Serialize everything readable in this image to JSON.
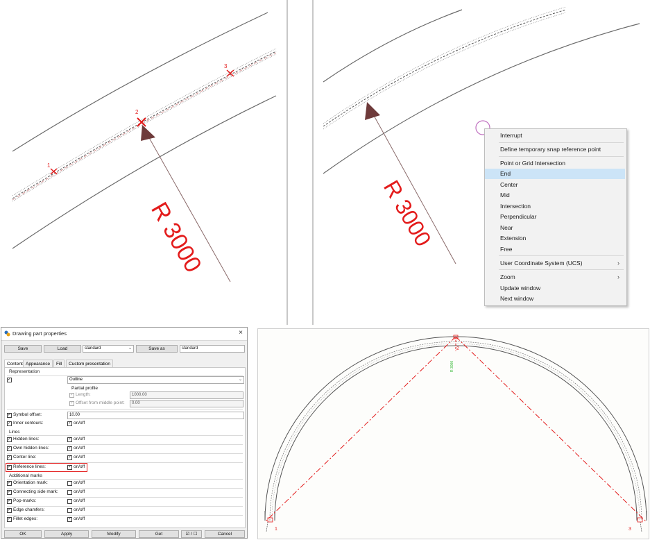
{
  "top_left": {
    "dimension_label": "R 3000",
    "point_labels": [
      "1",
      "2",
      "3"
    ]
  },
  "top_right": {
    "dimension_label": "R 3000",
    "context_menu": {
      "items": [
        {
          "label": "Interrupt"
        },
        {
          "label": "Define temporary snap reference point"
        },
        {
          "label": "Point or Grid Intersection"
        },
        {
          "label": "End",
          "selected": true
        },
        {
          "label": "Center"
        },
        {
          "label": "Mid"
        },
        {
          "label": "Intersection"
        },
        {
          "label": "Perpendicular"
        },
        {
          "label": "Near"
        },
        {
          "label": "Extension"
        },
        {
          "label": "Free"
        },
        {
          "label": "User Coordinate System (UCS)",
          "submenu": true
        },
        {
          "label": "Zoom",
          "submenu": true
        },
        {
          "label": "Update window"
        },
        {
          "label": "Next window"
        }
      ]
    }
  },
  "dialog": {
    "title": "Drawing part properties",
    "save_label": "Save",
    "load_label": "Load",
    "preset_value": "standard",
    "save_as_label": "Save as",
    "save_as_value": "standard",
    "tabs": [
      "Content",
      "Appearance",
      "Fill",
      "Custom presentation"
    ],
    "active_tab": "Content",
    "representation": {
      "section": "Representation",
      "value": "Outline",
      "partial_profile": "Partial profile",
      "length_label": "Length:",
      "length_value": "1000.00",
      "offset_label": "Offset from middle point:",
      "offset_value": "0.00",
      "symbol_offset_label": "Symbol offset:",
      "symbol_offset_value": "10.00",
      "inner_contours_label": "Inner contours:"
    },
    "onoff": "on/off",
    "lines_section": "Lines",
    "lines": [
      {
        "label": "Hidden lines:",
        "on": true
      },
      {
        "label": "Own hidden lines:",
        "on": true
      },
      {
        "label": "Center line:",
        "on": true
      },
      {
        "label": "Reference lines:",
        "on": true,
        "highlight": true
      }
    ],
    "marks_section": "Additional marks",
    "marks": [
      {
        "label": "Orientation mark:",
        "on": false
      },
      {
        "label": "Connecting side mark:",
        "on": false
      },
      {
        "label": "Pop-marks:",
        "on": false
      },
      {
        "label": "Edge chamfers:",
        "on": false
      },
      {
        "label": "Fillet edges:",
        "on": true
      }
    ],
    "footer": {
      "ok": "OK",
      "apply": "Apply",
      "modify": "Modify",
      "get": "Get",
      "toggle": "☑ / ☐",
      "cancel": "Cancel"
    }
  },
  "bottom_right": {
    "dimension_label": "R 3000",
    "point_labels": [
      "1",
      "2",
      "3"
    ]
  },
  "colors": {
    "accent_red": "#e31b1b",
    "arrow": "#6e3a3a",
    "menu_highlight": "#cce4f7",
    "green_dim": "#2bb52b"
  }
}
